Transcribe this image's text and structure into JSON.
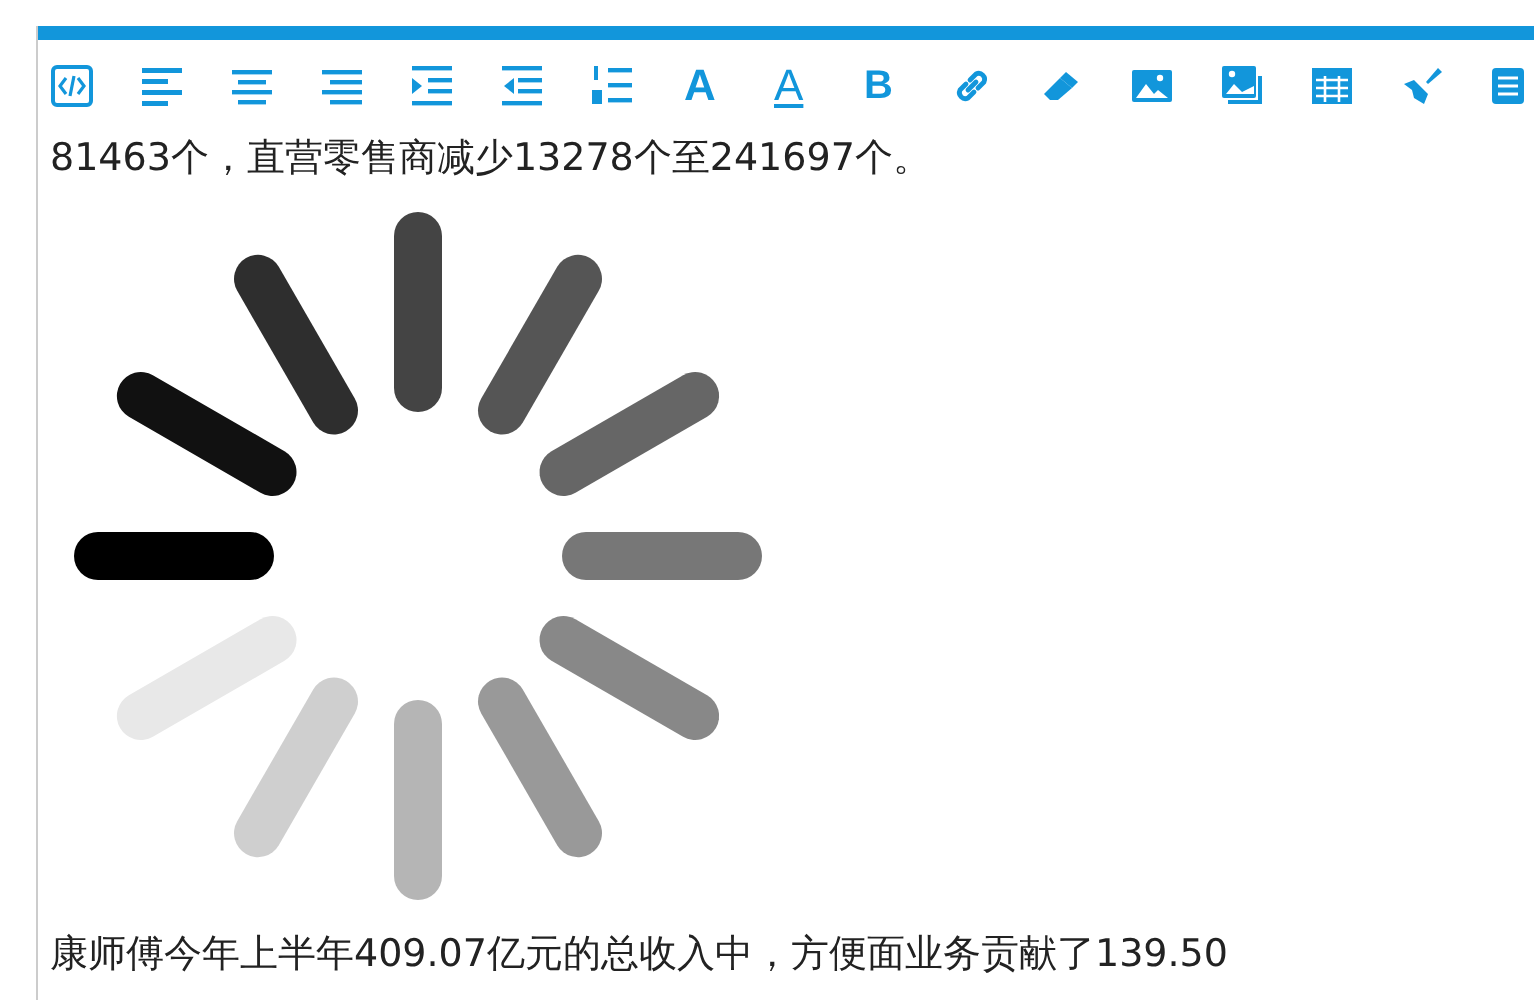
{
  "toolbar": [
    {
      "kind": "source"
    },
    {
      "kind": "align-left"
    },
    {
      "kind": "align-center"
    },
    {
      "kind": "align-right"
    },
    {
      "kind": "indent"
    },
    {
      "kind": "outdent"
    },
    {
      "kind": "ordered-list"
    },
    {
      "kind": "font-size",
      "glyph": "A"
    },
    {
      "kind": "font-color",
      "glyph": "A"
    },
    {
      "kind": "bold",
      "glyph": "B"
    },
    {
      "kind": "link"
    },
    {
      "kind": "eraser"
    },
    {
      "kind": "image"
    },
    {
      "kind": "gallery"
    },
    {
      "kind": "table"
    },
    {
      "kind": "brush"
    },
    {
      "kind": "more"
    }
  ],
  "content": [
    {
      "kind": "text",
      "text": "81463个，直营零售商减少13278个至241697个。"
    },
    {
      "kind": "spinner"
    },
    {
      "kind": "text",
      "text": "康师傅今年上半年409.07亿元的总收入中，方便面业务贡献了139.50"
    }
  ]
}
